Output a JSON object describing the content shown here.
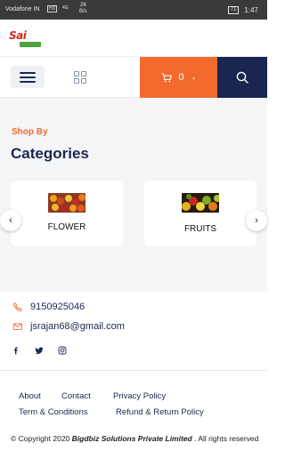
{
  "status_bar": {
    "carrier": "Vodafone IN",
    "hd": "HD",
    "signal": "4G",
    "net_speed": "26",
    "net_unit": "B/s",
    "battery": "71",
    "time": "1:47"
  },
  "header": {
    "logo_text": "Sai",
    "cart_count": "0"
  },
  "colors": {
    "accent": "#f26a2e",
    "navy": "#1a2650",
    "section_bg": "#f4f5f7"
  },
  "categories": {
    "kicker": "Shop By",
    "title": "Categories",
    "items": [
      {
        "name": "FLOWER",
        "icon": "flower-image"
      },
      {
        "name": "FRUITS",
        "icon": "fruits-image"
      }
    ]
  },
  "contact": {
    "phone": "9150925046",
    "email": "jsrajan68@gmail.com",
    "social": [
      "facebook-icon",
      "twitter-icon",
      "instagram-icon"
    ]
  },
  "footer": {
    "links": [
      "About",
      "Contact",
      "Privacy Policy",
      "Term & Conditions",
      "Refund & Return Policy"
    ],
    "copyright_prefix": "© Copyright 2020",
    "company": "Bigdbiz Solutions Private Limited",
    "copyright_suffix": ". All rights reserved"
  }
}
